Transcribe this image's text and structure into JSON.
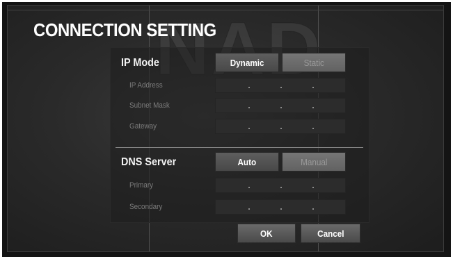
{
  "logo_text": "NAD",
  "title": "CONNECTION SETTING",
  "ip_mode": {
    "label": "IP Mode",
    "options": [
      "Dynamic",
      "Static"
    ],
    "selected": "Dynamic"
  },
  "ip_fields": [
    {
      "label": "IP Address"
    },
    {
      "label": "Subnet Mask"
    },
    {
      "label": "Gateway"
    }
  ],
  "dns": {
    "label": "DNS Server",
    "options": [
      "Auto",
      "Manual"
    ],
    "selected": "Auto"
  },
  "dns_fields": [
    {
      "label": "Primary"
    },
    {
      "label": "Secondary"
    }
  ],
  "actions": {
    "ok_label": "OK",
    "cancel_label": "Cancel"
  }
}
